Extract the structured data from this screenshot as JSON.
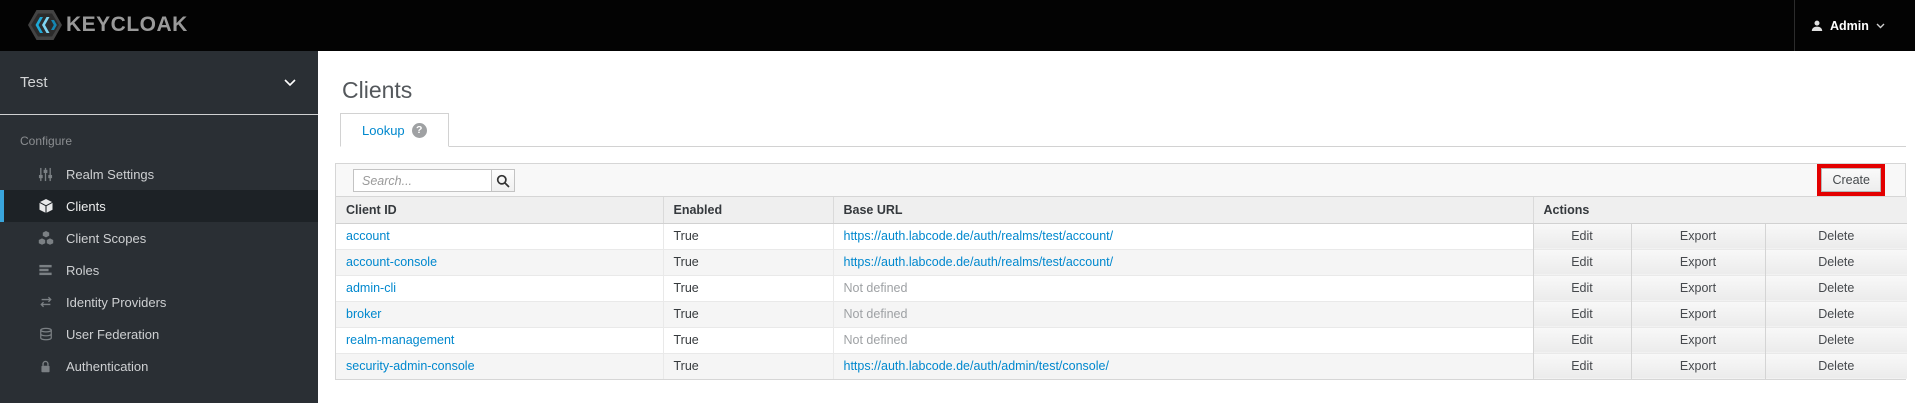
{
  "topbar": {
    "logo_text": "KEYCLOAK",
    "user_label": "Admin"
  },
  "sidebar": {
    "realm": "Test",
    "section_label": "Configure",
    "items": [
      {
        "label": "Realm Settings",
        "icon": "sliders-icon"
      },
      {
        "label": "Clients",
        "icon": "cube-icon",
        "active": true
      },
      {
        "label": "Client Scopes",
        "icon": "cubes-icon"
      },
      {
        "label": "Roles",
        "icon": "list-icon"
      },
      {
        "label": "Identity Providers",
        "icon": "exchange-icon"
      },
      {
        "label": "User Federation",
        "icon": "database-icon"
      },
      {
        "label": "Authentication",
        "icon": "lock-icon"
      }
    ]
  },
  "main": {
    "title": "Clients",
    "tab_label": "Lookup",
    "help_icon": "?",
    "search_placeholder": "Search...",
    "create_label": "Create",
    "table": {
      "headers": [
        "Client ID",
        "Enabled",
        "Base URL",
        "Actions"
      ],
      "action_labels": [
        "Edit",
        "Export",
        "Delete"
      ],
      "rows": [
        {
          "client_id": "account",
          "enabled": "True",
          "base_url": "https://auth.labcode.de/auth/realms/test/account/",
          "base_url_defined": true
        },
        {
          "client_id": "account-console",
          "enabled": "True",
          "base_url": "https://auth.labcode.de/auth/realms/test/account/",
          "base_url_defined": true
        },
        {
          "client_id": "admin-cli",
          "enabled": "True",
          "base_url": "Not defined",
          "base_url_defined": false
        },
        {
          "client_id": "broker",
          "enabled": "True",
          "base_url": "Not defined",
          "base_url_defined": false
        },
        {
          "client_id": "realm-management",
          "enabled": "True",
          "base_url": "Not defined",
          "base_url_defined": false
        },
        {
          "client_id": "security-admin-console",
          "enabled": "True",
          "base_url": "https://auth.labcode.de/auth/admin/test/console/",
          "base_url_defined": true
        }
      ]
    }
  },
  "colors": {
    "link_blue": "#0088ce",
    "nav_active_border": "#39a5dc",
    "annotation_red": "#e30000",
    "topbar_bg": "#030303",
    "sidebar_bg": "#2a2f34"
  }
}
